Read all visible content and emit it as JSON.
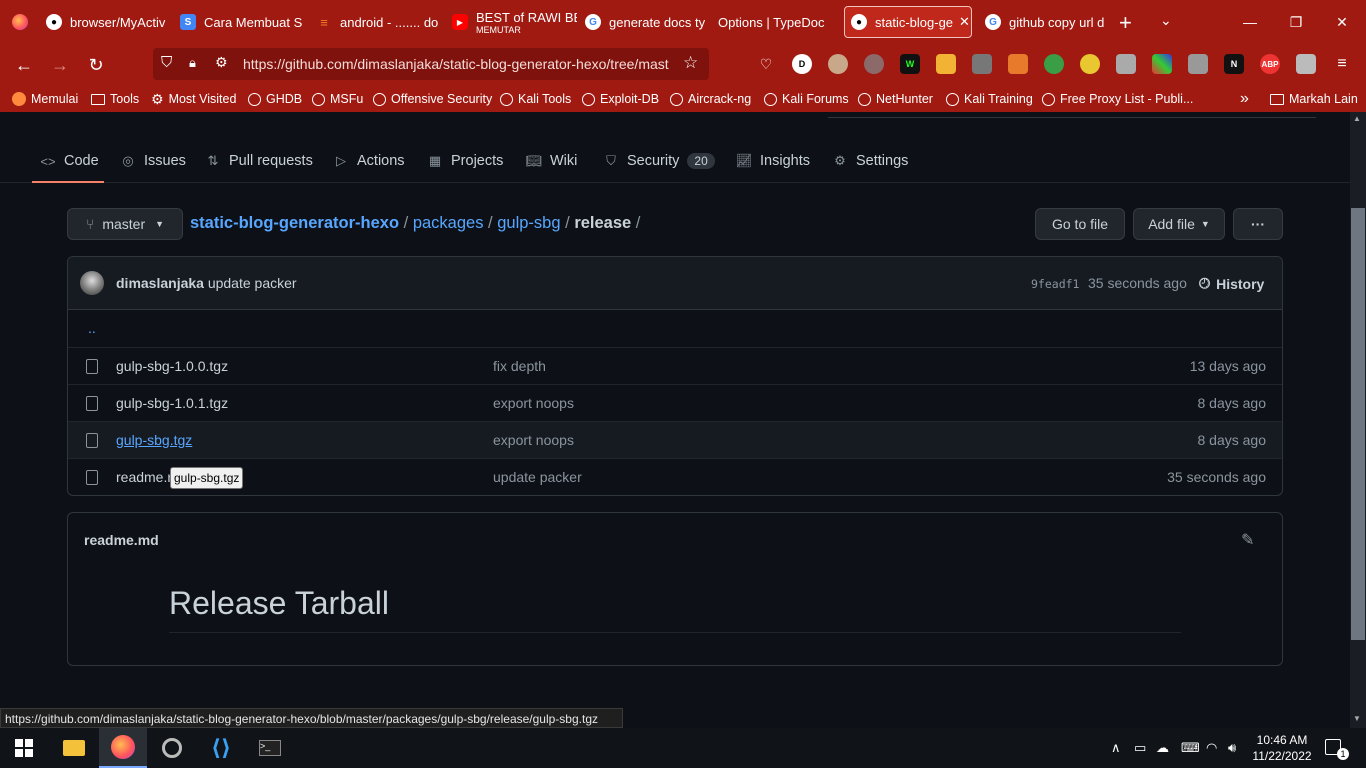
{
  "browser": {
    "tabs": [
      {
        "label": "browser/MyActiv",
        "icon": "github-icon"
      },
      {
        "label": "Cara Membuat S",
        "icon": "slides-icon"
      },
      {
        "label": "android - ....... do",
        "icon": "stackoverflow-icon"
      },
      {
        "label": "BEST of RAWI BE",
        "sub": "MEMUTAR",
        "icon": "youtube-icon"
      },
      {
        "label": "generate docs ty",
        "icon": "google-icon"
      },
      {
        "label": "Options | TypeDoc",
        "icon": ""
      },
      {
        "label": "static-blog-ge",
        "icon": "github-icon",
        "active": true
      },
      {
        "label": "github copy url d",
        "icon": "google-icon"
      }
    ],
    "url": "https://github.com/dimaslanjaka/static-blog-generator-hexo/tree/mast",
    "bookmarks": [
      "Memulai",
      "Tools",
      "Most Visited",
      "GHDB",
      "MSFu",
      "Offensive Security",
      "Kali Tools",
      "Exploit-DB",
      "Aircrack-ng",
      "Kali Forums",
      "NetHunter",
      "Kali Training",
      "Free Proxy List - Publi...",
      "Markah Lain"
    ],
    "extensions": [
      "D",
      "ABP"
    ],
    "status_url": "https://github.com/dimaslanjaka/static-blog-generator-hexo/blob/master/packages/gulp-sbg/release/gulp-sbg.tgz"
  },
  "repo_nav": {
    "tabs": [
      {
        "label": "Code",
        "icon": "code-icon",
        "active": true
      },
      {
        "label": "Issues",
        "icon": "issue-icon"
      },
      {
        "label": "Pull requests",
        "icon": "pull-request-icon"
      },
      {
        "label": "Actions",
        "icon": "play-icon"
      },
      {
        "label": "Projects",
        "icon": "table-icon"
      },
      {
        "label": "Wiki",
        "icon": "book-icon"
      },
      {
        "label": "Security",
        "icon": "shield-icon",
        "counter": "20"
      },
      {
        "label": "Insights",
        "icon": "graph-icon"
      },
      {
        "label": "Settings",
        "icon": "gear-icon"
      }
    ]
  },
  "file_nav": {
    "branch": "master",
    "breadcrumb": {
      "repo": "static-blog-generator-hexo",
      "p1": "packages",
      "p2": "gulp-sbg",
      "current": "release",
      "sep": "/"
    },
    "go_to_file": "Go to file",
    "add_file": "Add file",
    "more": "···"
  },
  "commit": {
    "author": "dimaslanjaka",
    "message": "update packer",
    "sha": "9feadf1",
    "time": "35 seconds ago",
    "history": "History"
  },
  "files": {
    "up": "..",
    "rows": [
      {
        "name": "gulp-sbg-1.0.0.tgz",
        "message": "fix depth",
        "age": "13 days ago"
      },
      {
        "name": "gulp-sbg-1.0.1.tgz",
        "message": "export noops",
        "age": "8 days ago"
      },
      {
        "name": "gulp-sbg.tgz",
        "message": "export noops",
        "age": "8 days ago"
      },
      {
        "name": "readme.r",
        "message": "update packer",
        "age": "35 seconds ago"
      }
    ],
    "tooltip": "gulp-sbg.tgz"
  },
  "readme": {
    "filename": "readme.md",
    "heading": "Release Tarball"
  },
  "taskbar": {
    "time": "10:46 AM",
    "date": "11/22/2022",
    "notifications": "1"
  },
  "colors": {
    "accent": "#58a6ff",
    "browser_chrome": "#a01a12",
    "bg": "#0d1117"
  }
}
